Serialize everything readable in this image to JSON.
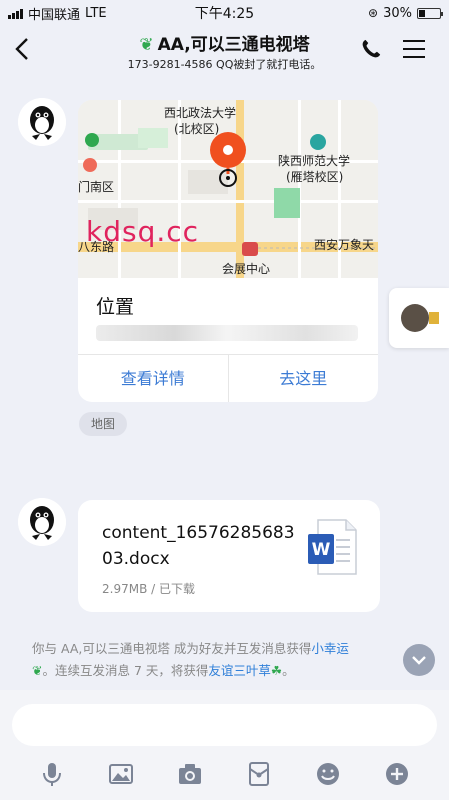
{
  "status_bar": {
    "carrier": "中国联通",
    "network": "LTE",
    "time": "下午4:25",
    "battery": "30%",
    "battery_level": 0.3
  },
  "nav": {
    "title": "AA,可以三通电视塔",
    "subtitle": "173-9281-4586 QQ被封了就打电话。"
  },
  "location_message": {
    "map_labels": {
      "school1_line1": "西北政法大学",
      "school1_line2": "(北校区)",
      "school2_line1": "陕西师范大学",
      "school2_line2": "(雁塔校区)",
      "district": "门南区",
      "road": "八东路",
      "center": "会展中心",
      "right_label": "西安万象天"
    },
    "watermark": "kdsq.cc",
    "title": "位置",
    "action_details": "查看详情",
    "action_go": "去这里"
  },
  "map_tag": "地图",
  "file_message": {
    "file_name": "content_1657628568303.docx",
    "file_meta": "2.97MB / 已下载",
    "icon_letter": "W"
  },
  "system_message": {
    "part1": "你与 AA,可以三通电视塔",
    "part2": " 成为好友并互发消息获得",
    "link1": "小幸运",
    "part3": "。连续互发消息 7 天，将获得",
    "link2": "友谊三叶草",
    "part4": "。"
  },
  "colors": {
    "accent": "#3c7bd4",
    "link": "#2f7fd8",
    "sprout": "#2fa84f",
    "pin": "#f0501f",
    "watermark": "#e0245e"
  }
}
